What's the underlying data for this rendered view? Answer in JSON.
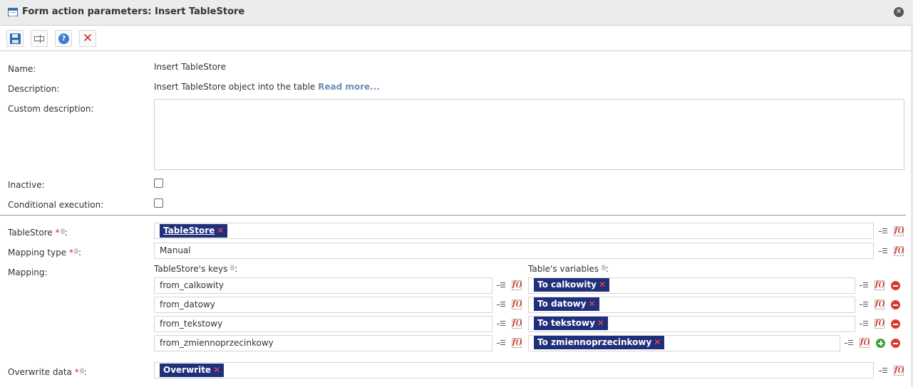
{
  "window": {
    "title": "Form action parameters: Insert TableStore"
  },
  "toolbar": {
    "save_label": "",
    "rename_label": "",
    "help_label": "?",
    "cancel_label": "✕"
  },
  "form": {
    "name": {
      "label": "Name:",
      "value": "Insert TableStore"
    },
    "description": {
      "label": "Description:",
      "value": "Insert TableStore object into the table",
      "read_more": "Read more..."
    },
    "custom_description": {
      "label": "Custom description:",
      "value": ""
    },
    "inactive": {
      "label": "Inactive:",
      "checked": false
    },
    "conditional_execution": {
      "label": "Conditional execution:",
      "checked": false
    },
    "tablestore": {
      "label": "TableStore",
      "required_mark": "*",
      "suffix": ":",
      "chip": "TableStore"
    },
    "mapping_type": {
      "label": "Mapping type",
      "required_mark": "*",
      "suffix": ":",
      "value": "Manual"
    },
    "mapping": {
      "label": "Mapping:",
      "keys_header": "TableStore's keys",
      "vars_header": "Table's variables",
      "header_suffix": ":",
      "rows": [
        {
          "key": "from_calkowity",
          "variable": "To calkowity"
        },
        {
          "key": "from_datowy",
          "variable": "To datowy"
        },
        {
          "key": "from_tekstowy",
          "variable": "To tekstowy"
        },
        {
          "key": "from_zmiennoprzecinkowy",
          "variable": "To zmiennoprzecinkowy"
        }
      ]
    },
    "overwrite_data": {
      "label": "Overwrite data",
      "required_mark": "*",
      "suffix": ":",
      "chip": "Overwrite"
    }
  },
  "glyphs": {
    "chip_remove": "✕",
    "function": "f()"
  },
  "colors": {
    "chip_bg": "#1f2f7a",
    "required": "#e02222",
    "link": "#6b8fb3",
    "separator": "#7b9ab8"
  }
}
